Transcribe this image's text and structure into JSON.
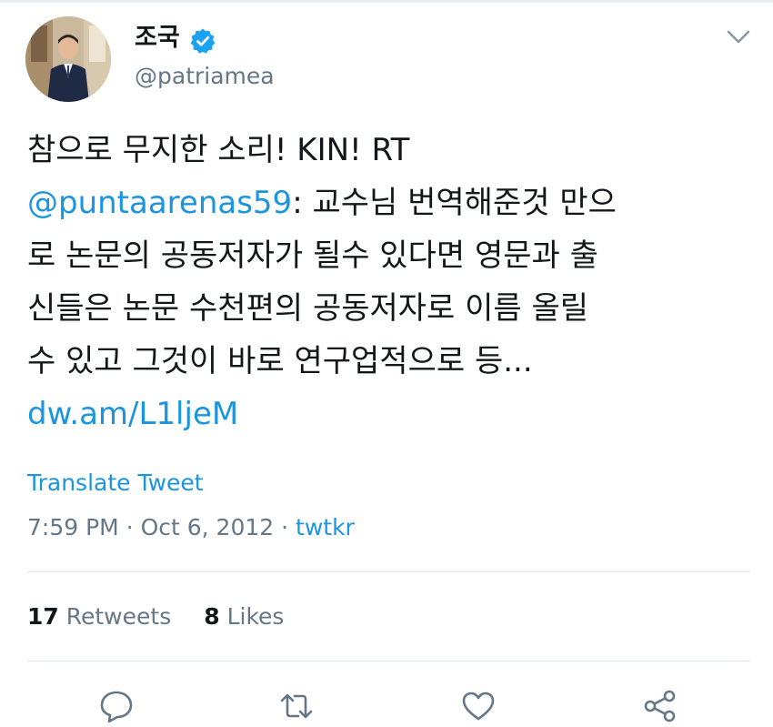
{
  "author": {
    "name": "조국",
    "handle": "@patriamea",
    "verified": true
  },
  "tweet": {
    "lines": [
      [
        {
          "text": "참으로 무지한 소리! KIN! RT",
          "kind": "plain"
        }
      ],
      [
        {
          "text": "@puntaarenas59",
          "kind": "link"
        },
        {
          "text": ": 교수님 번역해준것 만으",
          "kind": "plain"
        }
      ],
      [
        {
          "text": "로 논문의 공동저자가 될수 있다면 영문과 출",
          "kind": "plain"
        }
      ],
      [
        {
          "text": "신들은 논문 수천편의 공동저자로 이름 올릴",
          "kind": "plain"
        }
      ],
      [
        {
          "text": "수 있고 그것이 바로 연구업적으로 등...",
          "kind": "plain"
        }
      ],
      [
        {
          "text": "dw.am/L1ljeM",
          "kind": "link"
        }
      ]
    ]
  },
  "translate_label": "Translate Tweet",
  "meta": {
    "time": "7:59 PM",
    "separator": " · ",
    "date": "Oct 6, 2012",
    "source": "twtkr"
  },
  "stats": {
    "retweets_count": "17",
    "retweets_label": "Retweets",
    "likes_count": "8",
    "likes_label": "Likes"
  },
  "actions": [
    "reply-icon",
    "retweet-icon",
    "like-icon",
    "share-icon"
  ],
  "colors": {
    "link": "#1b95e0",
    "muted": "#657786",
    "text": "#14171a",
    "verified": "#1da1f2",
    "divider": "#e1e8ed"
  }
}
